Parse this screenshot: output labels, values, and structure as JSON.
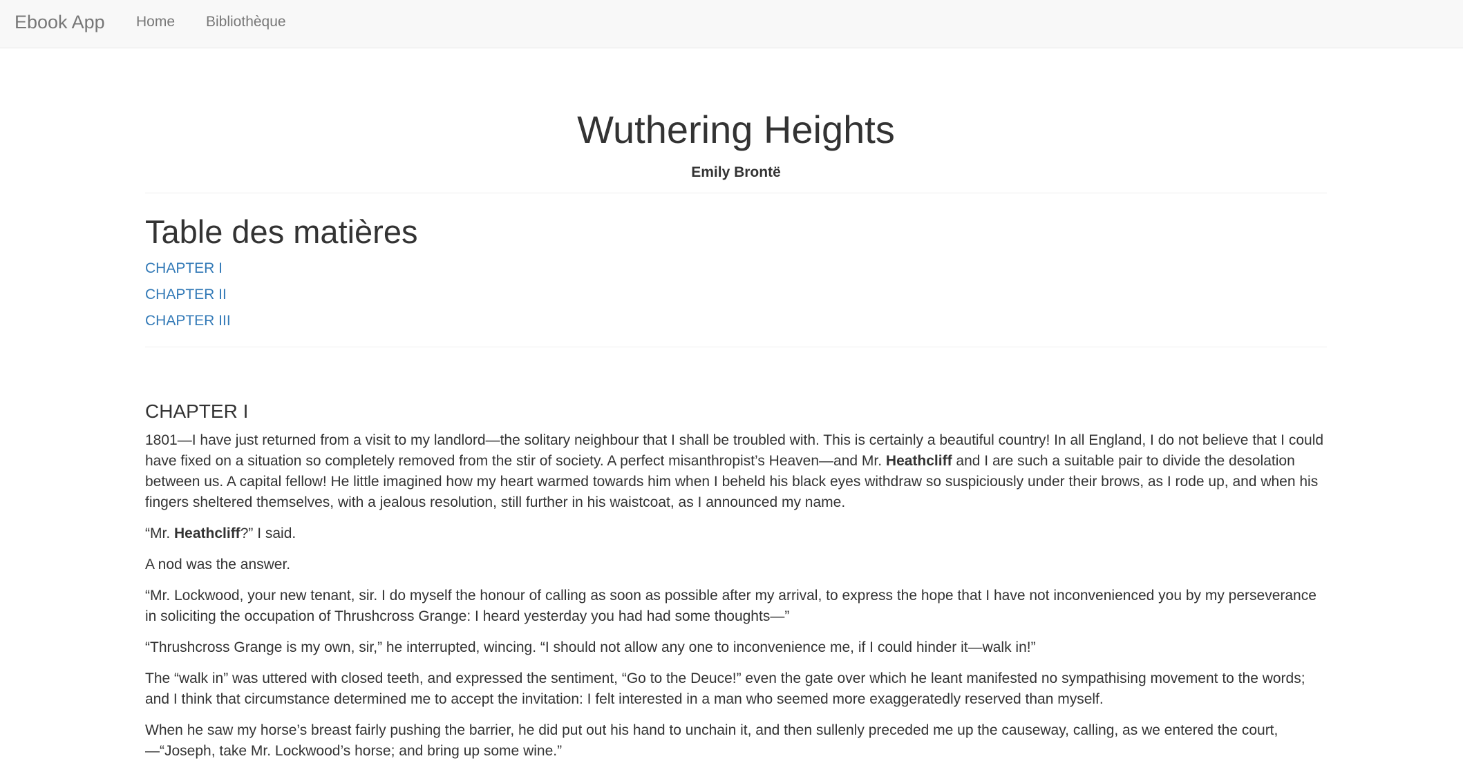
{
  "nav": {
    "brand": "Ebook App",
    "links": [
      {
        "label": "Home"
      },
      {
        "label": "Bibliothèque"
      }
    ]
  },
  "book": {
    "title": "Wuthering Heights",
    "author": "Emily Brontë"
  },
  "toc": {
    "title": "Table des matières",
    "chapters": [
      {
        "label": "CHAPTER I"
      },
      {
        "label": "CHAPTER II"
      },
      {
        "label": "CHAPTER III"
      }
    ]
  },
  "chapter": {
    "heading": "CHAPTER I",
    "paragraphs": [
      {
        "parts": [
          {
            "text": "1801—I have just returned from a visit to my landlord—the solitary neighbour that I shall be troubled with. This is certainly a beautiful country! In all England, I do not believe that I could have fixed on a situation so completely removed from the stir of society. A perfect misanthropist’s Heaven—and Mr. "
          },
          {
            "text": "Heathcliff",
            "bold": true
          },
          {
            "text": " and I are such a suitable pair to divide the desolation between us. A capital fellow! He little imagined how my heart warmed towards him when I beheld his black eyes withdraw so suspiciously under their brows, as I rode up, and when his fingers sheltered themselves, with a jealous resolution, still further in his waistcoat, as I announced my name."
          }
        ]
      },
      {
        "parts": [
          {
            "text": "“Mr. "
          },
          {
            "text": "Heathcliff",
            "bold": true
          },
          {
            "text": "?” I said."
          }
        ]
      },
      {
        "parts": [
          {
            "text": "A nod was the answer."
          }
        ]
      },
      {
        "parts": [
          {
            "text": "“Mr. Lockwood, your new tenant, sir. I do myself the honour of calling as soon as possible after my arrival, to express the hope that I have not inconvenienced you by my perseverance in soliciting the occupation of Thrushcross Grange: I heard yesterday you had had some thoughts—”"
          }
        ]
      },
      {
        "parts": [
          {
            "text": "“Thrushcross Grange is my own, sir,” he interrupted, wincing. “I should not allow any one to inconvenience me, if I could hinder it—walk in!”"
          }
        ]
      },
      {
        "parts": [
          {
            "text": "The “walk in” was uttered with closed teeth, and expressed the sentiment, “Go to the Deuce!” even the gate over which he leant manifested no sympathising movement to the words; and I think that circumstance determined me to accept the invitation: I felt interested in a man who seemed more exaggeratedly reserved than myself."
          }
        ]
      },
      {
        "parts": [
          {
            "text": "When he saw my horse’s breast fairly pushing the barrier, he did put out his hand to unchain it, and then sullenly preceded me up the causeway, calling, as we entered the court,—“Joseph, take Mr. Lockwood’s horse; and bring up some wine.”"
          }
        ]
      }
    ]
  }
}
